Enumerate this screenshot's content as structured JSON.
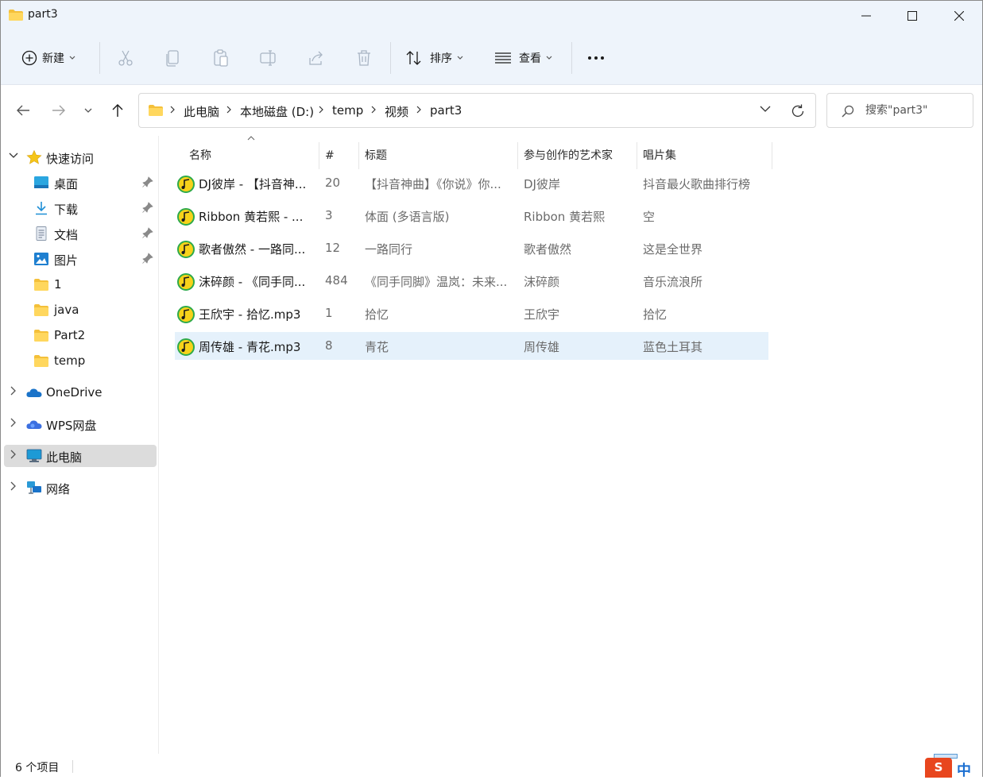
{
  "window": {
    "title": "part3"
  },
  "toolbar": {
    "new_label": "新建",
    "sort_label": "排序",
    "view_label": "查看"
  },
  "breadcrumb": [
    "此电脑",
    "本地磁盘 (D:)",
    "temp",
    "视频",
    "part3"
  ],
  "search": {
    "placeholder": "搜索\"part3\""
  },
  "sidebar": {
    "quick_access": "快速访问",
    "items": [
      {
        "label": "桌面",
        "icon": "desktop-icon"
      },
      {
        "label": "下载",
        "icon": "download-icon"
      },
      {
        "label": "文档",
        "icon": "document-icon"
      },
      {
        "label": "图片",
        "icon": "pictures-icon"
      },
      {
        "label": "1",
        "icon": "folder-icon"
      },
      {
        "label": "java",
        "icon": "folder-icon"
      },
      {
        "label": "Part2",
        "icon": "folder-icon"
      },
      {
        "label": "temp",
        "icon": "folder-icon"
      }
    ],
    "onedrive": "OneDrive",
    "wps": "WPS网盘",
    "this_pc": "此电脑",
    "network": "网络"
  },
  "columns": {
    "name": "名称",
    "track": "#",
    "title": "标题",
    "artist": "参与创作的艺术家",
    "album": "唱片集"
  },
  "files": [
    {
      "name": "DJ彼岸 - 【抖音神...",
      "track": "20",
      "title": "【抖音神曲】《你说》你...",
      "artist": "DJ彼岸",
      "album": "抖音最火歌曲排行榜"
    },
    {
      "name": "Ribbon 黄若熙 - ...",
      "track": "3",
      "title": "体面 (多语言版)",
      "artist": "Ribbon 黄若熙",
      "album": "空"
    },
    {
      "name": "歌者傲然 - 一路同...",
      "track": "12",
      "title": "一路同行",
      "artist": "歌者傲然",
      "album": "这是全世界"
    },
    {
      "name": "沫碎颜 - 《同手同...",
      "track": "484",
      "title": "《同手同脚》温岚：未来...",
      "artist": "沫碎颜",
      "album": "音乐流浪所"
    },
    {
      "name": "王欣宇 - 拾忆.mp3",
      "track": "1",
      "title": "拾忆",
      "artist": "王欣宇",
      "album": "拾忆"
    },
    {
      "name": "周传雄 - 青花.mp3",
      "track": "8",
      "title": "青花",
      "artist": "周传雄",
      "album": "蓝色土耳其"
    }
  ],
  "status": {
    "count": "6 个项目",
    "ime_label": "S",
    "ime_lang": "中"
  },
  "colors": {
    "accent": "#0067c0",
    "selection": "#e5f1fb",
    "toolbar_bg": "#eef4fb"
  }
}
